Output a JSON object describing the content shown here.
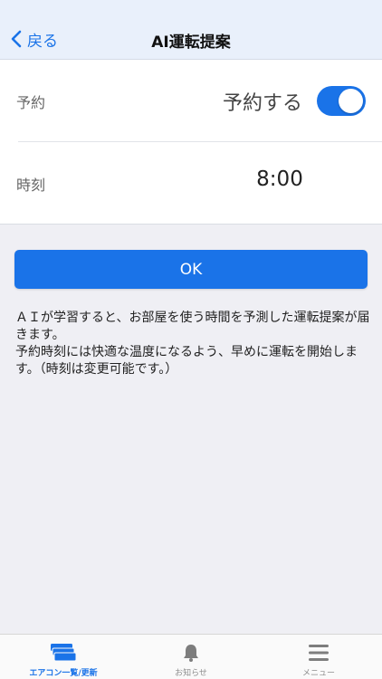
{
  "nav": {
    "back_label": "戻る",
    "title": "AI運転提案"
  },
  "reservation": {
    "label": "予約",
    "value_text": "予約する",
    "toggle_on": true
  },
  "time": {
    "label": "時刻",
    "value": "8:00"
  },
  "ok_button": "OK",
  "description": {
    "line1": "ＡＩが学習すると、お部屋を使う時間を予測した運転提案が届きます。",
    "line2": "予約時刻には快適な温度になるよう、早めに運転を開始します。（時刻は変更可能です。）"
  },
  "tabs": [
    {
      "label": "エアコン一覧/更新",
      "icon": "aircon-icon",
      "active": true
    },
    {
      "label": "お知らせ",
      "icon": "bell-icon",
      "active": false
    },
    {
      "label": "メニュー",
      "icon": "menu-icon",
      "active": false
    }
  ],
  "colors": {
    "accent": "#1a73e8",
    "nav_bg": "#e9f0fb",
    "page_bg": "#efeff4"
  }
}
